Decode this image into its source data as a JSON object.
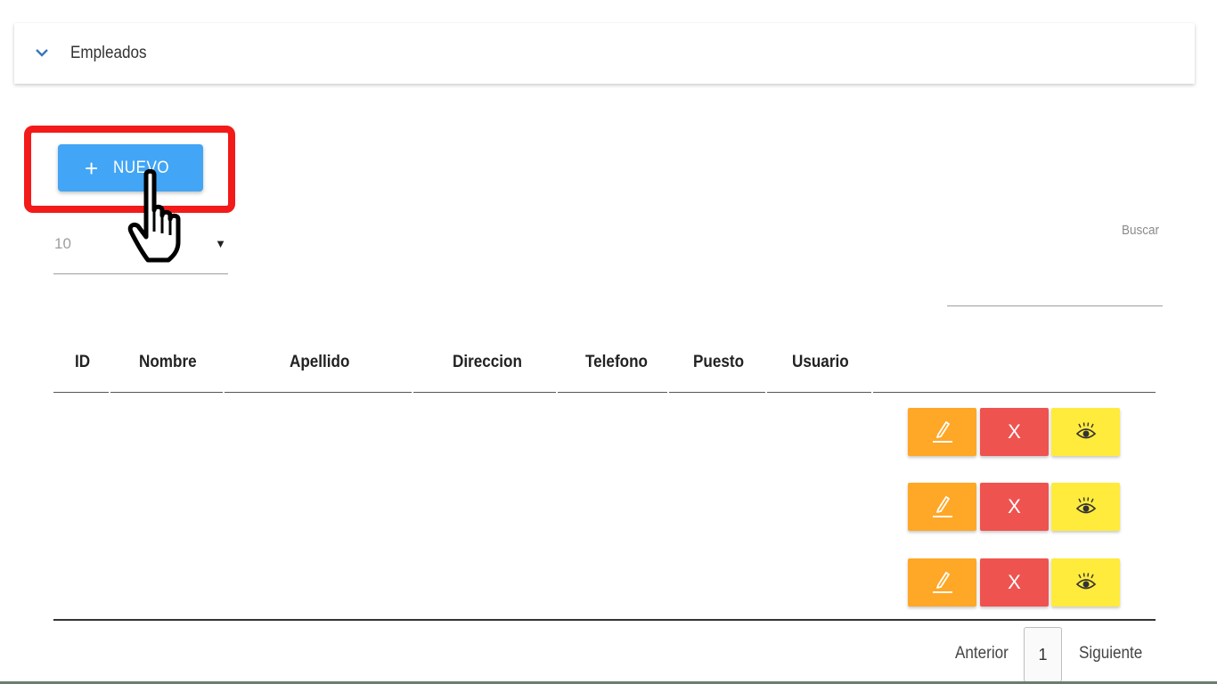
{
  "panel": {
    "title": "Empleados"
  },
  "toolbar": {
    "new_button_label": "NUEVO"
  },
  "page_size": {
    "value": "10"
  },
  "search": {
    "label": "Buscar",
    "value": ""
  },
  "table": {
    "columns": [
      "ID",
      "Nombre",
      "Apellido",
      "Direccion",
      "Telefono",
      "Puesto",
      "Usuario"
    ],
    "rows": [
      {
        "actions": [
          "edit",
          "delete",
          "view"
        ]
      },
      {
        "actions": [
          "edit",
          "delete",
          "view"
        ]
      },
      {
        "actions": [
          "edit",
          "delete",
          "view"
        ]
      }
    ],
    "delete_label": "X"
  },
  "pagination": {
    "previous": "Anterior",
    "current_page": "1",
    "next": "Siguiente"
  },
  "colors": {
    "primary": "#42a5f5",
    "highlight": "#f31a1a",
    "edit": "#ffa726",
    "delete": "#ef5350",
    "view": "#ffeb3b"
  },
  "icons": [
    "chevron-down-icon",
    "plus-icon",
    "pointer-hand-icon",
    "dropdown-caret-icon",
    "pencil-icon",
    "eye-icon"
  ]
}
